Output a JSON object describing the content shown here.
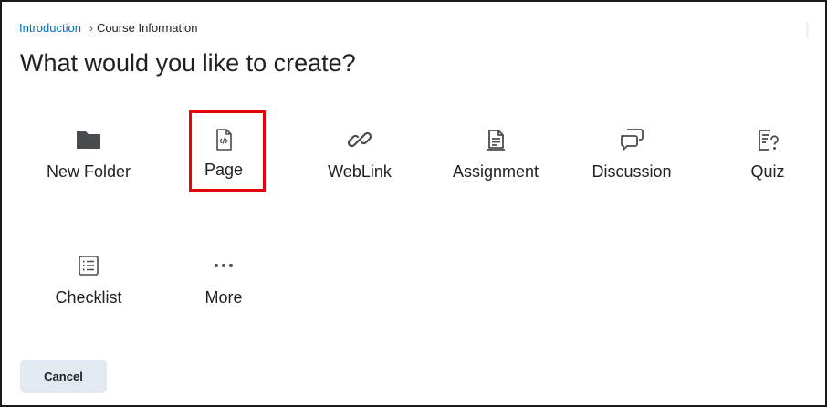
{
  "breadcrumb": {
    "link_label": "Introduction",
    "separator": "›",
    "current_label": "Course Information"
  },
  "title": "What would you like to create?",
  "options": [
    {
      "label": "New Folder",
      "icon": "folder-icon"
    },
    {
      "label": "Page",
      "icon": "page-code-icon"
    },
    {
      "label": "WebLink",
      "icon": "link-icon"
    },
    {
      "label": "Assignment",
      "icon": "assignment-icon"
    },
    {
      "label": "Discussion",
      "icon": "discussion-icon"
    },
    {
      "label": "Quiz",
      "icon": "quiz-icon"
    },
    {
      "label": "Checklist",
      "icon": "checklist-icon"
    },
    {
      "label": "More",
      "icon": "more-icon"
    }
  ],
  "highlight": {
    "target": "Page",
    "color": "#e0060a"
  },
  "footer": {
    "cancel_label": "Cancel"
  },
  "colors": {
    "link": "#006fbf",
    "button_bg": "#e3e9f1",
    "text": "#202122"
  }
}
